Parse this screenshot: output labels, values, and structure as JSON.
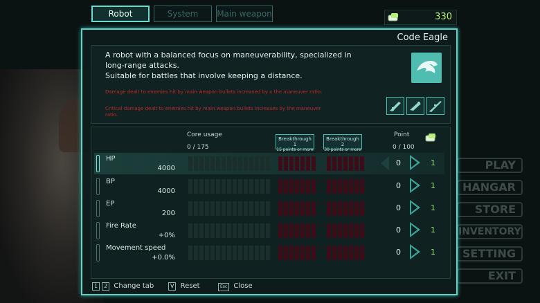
{
  "tabs": [
    {
      "label": "Robot",
      "active": true
    },
    {
      "label": "System",
      "active": false
    },
    {
      "label": "Main weapon",
      "active": false
    }
  ],
  "currency": {
    "value": "330",
    "icon": "credit-chip-icon"
  },
  "background_menu": [
    "PLAY",
    "HANGAR",
    "STORE",
    "INVENTORY",
    "SETTING",
    "EXIT"
  ],
  "robot": {
    "name": "Code Eagle",
    "description": [
      "A robot with a balanced focus on maneuverability, specialized in",
      "long-range attacks.",
      "Suitable for battles that involve keeping a distance."
    ],
    "bonus_text": [
      "Damage dealt to enemies hit by main weapon bullets increased by x the maneuver ratio.",
      "Critical damage dealt to enemies hit by main weapon bullets increases by the maneuver",
      "ratio."
    ],
    "emblem_icon": "eagle-emblem-icon",
    "weapon_icons": [
      "rifle-icon",
      "shotgun-icon",
      "sniper-icon"
    ]
  },
  "stats_header": {
    "core_usage_label": "Core usage",
    "core_usage_value": "0 / 175",
    "breakthrough1_title": "Breakthrough 1",
    "breakthrough1_sub": "15 points or more",
    "breakthrough2_title": "Breakthrough 2",
    "breakthrough2_sub": "30 points or more",
    "point_label": "Point",
    "point_value": "0 / 100"
  },
  "stats": [
    {
      "name": "HP",
      "value": "4000",
      "points": "0",
      "cost": "1",
      "selected": true
    },
    {
      "name": "BP",
      "value": "4000",
      "points": "0",
      "cost": "1",
      "selected": false
    },
    {
      "name": "EP",
      "value": "200",
      "points": "0",
      "cost": "1",
      "selected": false
    },
    {
      "name": "Fire Rate",
      "value": "+0%",
      "points": "0",
      "cost": "1",
      "selected": false
    },
    {
      "name": "Movement speed",
      "value": "+0.0%",
      "points": "0",
      "cost": "1",
      "selected": false
    }
  ],
  "footer": {
    "key1": "1",
    "key2": "2",
    "change_tab": "Change tab",
    "key_reset": "V",
    "reset": "Reset",
    "key_close": "Esc",
    "close": "Close"
  },
  "colors": {
    "accent": "#5fd5ca",
    "breakthrough": "#3c0c18",
    "cost": "#9fe07a"
  }
}
